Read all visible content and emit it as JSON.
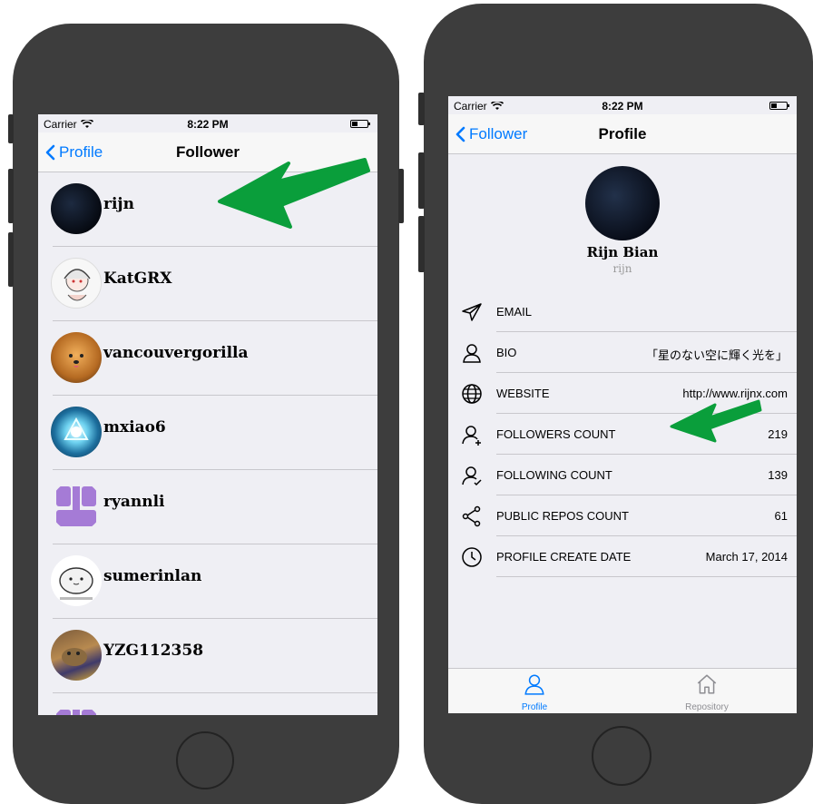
{
  "left_screen": {
    "status": {
      "carrier": "Carrier",
      "time": "8:22 PM"
    },
    "nav": {
      "back": "Profile",
      "title": "Follower"
    },
    "followers": [
      {
        "name": "rijn"
      },
      {
        "name": "KatGRX"
      },
      {
        "name": "vancouvergorilla"
      },
      {
        "name": "mxiao6"
      },
      {
        "name": "ryannli"
      },
      {
        "name": "sumerinlan"
      },
      {
        "name": "YZG112358"
      }
    ]
  },
  "right_screen": {
    "status": {
      "carrier": "Carrier",
      "time": "8:22 PM"
    },
    "nav": {
      "back": "Follower",
      "title": "Profile"
    },
    "profile": {
      "name": "Rijn Bian",
      "login": "rijn"
    },
    "rows": [
      {
        "label": "EMAIL",
        "value": "",
        "icon": "paper-plane-icon"
      },
      {
        "label": "BIO",
        "value": "「星のない空に輝く光を」",
        "icon": "person-icon"
      },
      {
        "label": "WEBSITE",
        "value": "http://www.rijnx.com",
        "icon": "globe-icon"
      },
      {
        "label": "FOLLOWERS COUNT",
        "value": "219",
        "icon": "person-plus-icon"
      },
      {
        "label": "FOLLOWING COUNT",
        "value": "139",
        "icon": "person-check-icon"
      },
      {
        "label": "PUBLIC REPOS COUNT",
        "value": "61",
        "icon": "share-icon"
      },
      {
        "label": "PROFILE CREATE DATE",
        "value": "March 17, 2014",
        "icon": "clock-icon"
      }
    ],
    "tabs": [
      {
        "label": "Profile",
        "icon": "person-icon",
        "active": true
      },
      {
        "label": "Repository",
        "icon": "house-icon",
        "active": false
      }
    ]
  },
  "colors": {
    "accent": "#007aff",
    "arrow": "#0a9e3b",
    "phone": "#3d3d3d"
  }
}
